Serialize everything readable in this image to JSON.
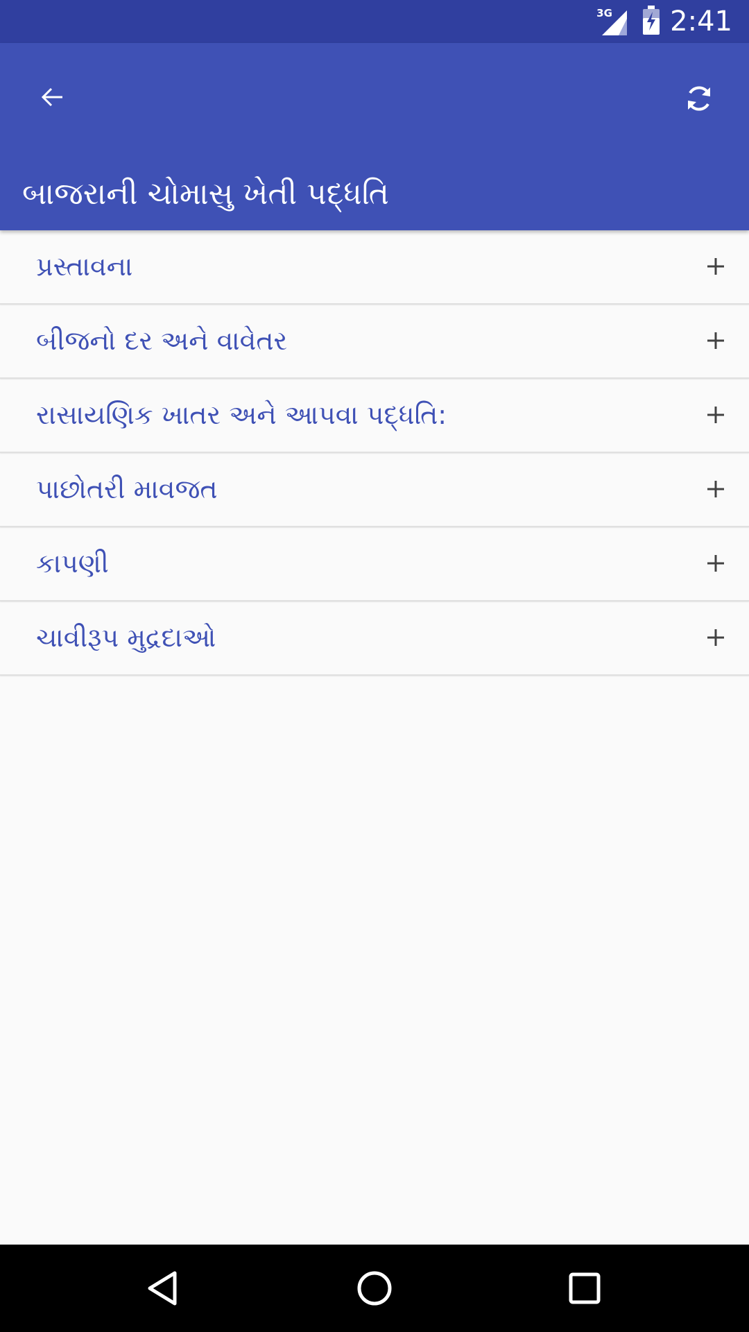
{
  "status_bar": {
    "network": "3G",
    "time": "2:41",
    "icons": [
      "signal-icon",
      "battery-charging-icon"
    ]
  },
  "app_bar": {
    "title": "બાજરાની ચોમાસુ ખેતી પદ્ધતિ",
    "back_icon": "arrow-left-icon",
    "refresh_icon": "refresh-icon",
    "background_color": "#3f51b5",
    "status_color": "#303f9f"
  },
  "sections": [
    {
      "label": "પ્રસ્તાવના",
      "icon": "plus-icon"
    },
    {
      "label": "બીજનો દર અને   વાવેતર",
      "icon": "plus-icon"
    },
    {
      "label": "રાસાયણિક ખાતર અને આપવા પદ્ધતિ:",
      "icon": "plus-icon"
    },
    {
      "label": "પાછોતરી માવજત",
      "icon": "plus-icon"
    },
    {
      "label": "કાપણી",
      "icon": "plus-icon"
    },
    {
      "label": "ચાવીરૂપ  મુદ્રદાઓ",
      "icon": "plus-icon"
    }
  ],
  "colors": {
    "accent_text": "#3f51b5",
    "background": "#fafafa",
    "divider": "#e0e0e0",
    "icon_dark": "#424242"
  },
  "nav_bar": {
    "buttons": [
      "back-triangle-icon",
      "home-circle-icon",
      "recents-square-icon"
    ]
  }
}
